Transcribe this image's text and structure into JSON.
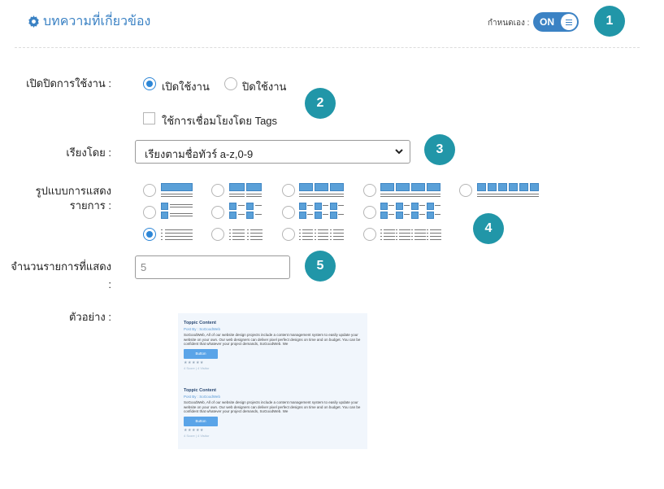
{
  "header": {
    "title": "บทความที่เกี่ยวข้อง",
    "custom_label": "กำหนดเอง :",
    "toggle_label": "ON"
  },
  "badges": [
    "1",
    "2",
    "3",
    "4",
    "5"
  ],
  "enable": {
    "label": "เปิดปิดการใช้งาน :",
    "options": [
      "เปิดใช้งาน",
      "ปิดใช้งาน"
    ],
    "selected": "เปิดใช้งาน",
    "tags_checkbox_label": "ใช้การเชื่อมโยงโดย Tags",
    "tags_checked": false
  },
  "sort": {
    "label": "เรียงโดย :",
    "selected": "เรียงตามชื่อทัวร์ a-z,0-9"
  },
  "layout": {
    "label_line1": "รูปแบบการแสดง",
    "label_line2": "รายการ :",
    "selected_row": 3,
    "selected_col": 1
  },
  "count": {
    "label_line1": "จำนวนรายการที่แสดง",
    "label_line2": ":",
    "value": "5"
  },
  "example": {
    "label": "ตัวอย่าง :",
    "items": [
      {
        "title": "Toppic Content",
        "by": "Post By : SoGoodWeb",
        "body": "SoGoodWeb, All of our website design projects include a content management system to easily update your website on your own. Our web designers can deliver pixel perfect designs on time and on budget. You can be confident that whatever your project demands, SoGoodWeb. We",
        "button": "Button",
        "stars": "★★★★★",
        "footer": "4 Score | 4 Visitor"
      },
      {
        "title": "Toppic Content",
        "by": "Post By : SoGoodWeb",
        "body": "SoGoodWeb, All of our website design projects include a content management system to easily update your website on your own. Our web designers can deliver pixel perfect designs on time and on budget. You can be confident that whatever your project demands, SoGoodWeb. We",
        "button": "Button",
        "stars": "★★★★★",
        "footer": "4 Score | 4 Visitor"
      }
    ]
  },
  "colors": {
    "accent": "#3b82c4",
    "badge": "#2196a8",
    "layout_block": "#5aa0d8"
  },
  "icons": {
    "title": "gear-icon",
    "toggle": "menu-lines-icon",
    "select": "chevron-down-icon"
  }
}
